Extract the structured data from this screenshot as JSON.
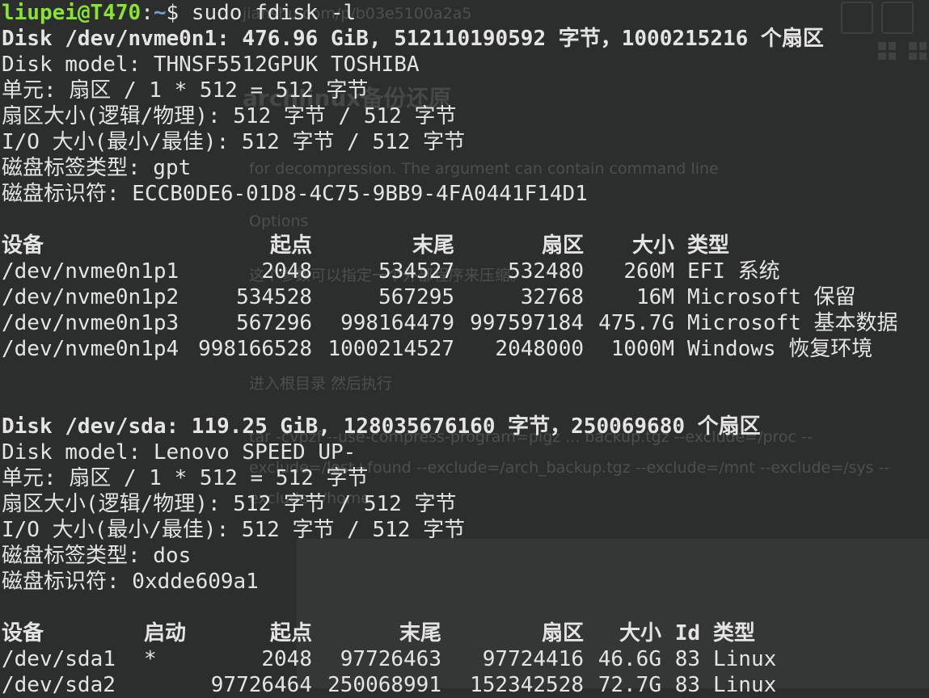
{
  "background": {
    "url_fragment": "jianshu.com/p/b03e5100a2a5",
    "heading": "archlinux备份还原",
    "line1": "for decompression. The argument can contain command line",
    "line2": "Options",
    "line3": "这个参数可以指定一个外部程序来压缩。",
    "line4": "进入根目录 然后执行",
    "line5": "tar -cvpzf --use-compress-program=pigz ... backup.tgz --exclude=/proc --",
    "line6": "exclude=/lost+found --exclude=/arch_backup.tgz --exclude=/mnt --exclude=/sys --",
    "line7": "exclude=/home"
  },
  "prompt": {
    "user_host": "liupei@T470",
    "sep": ":",
    "path": "~",
    "symbol": "$ ",
    "command": "sudo fdisk -l"
  },
  "disk1": {
    "header": "Disk /dev/nvme0n1: 476.96 GiB, 512110190592 字节，1000215216 个扇区",
    "model": "Disk model: THNSF5512GPUK TOSHIBA",
    "unit": "单元: 扇区 / 1 * 512 = 512 字节",
    "sector_size": "扇区大小(逻辑/物理): 512 字节 / 512 字节",
    "io_size": "I/O 大小(最小/最佳): 512 字节 / 512 字节",
    "label_type": "磁盘标签类型: gpt",
    "identifier": "磁盘标识符: ECCB0DE6-01D8-4C75-9BB9-4FA0441F14D1",
    "columns": [
      "设备",
      "起点",
      "末尾",
      "扇区",
      "大小",
      "类型"
    ],
    "rows": [
      [
        "/dev/nvme0n1p1",
        "2048",
        "534527",
        "532480",
        "260M",
        "EFI 系统"
      ],
      [
        "/dev/nvme0n1p2",
        "534528",
        "567295",
        "32768",
        "16M",
        "Microsoft 保留"
      ],
      [
        "/dev/nvme0n1p3",
        "567296",
        "998164479",
        "997597184",
        "475.7G",
        "Microsoft 基本数据"
      ],
      [
        "/dev/nvme0n1p4",
        "998166528",
        "1000214527",
        "2048000",
        "1000M",
        "Windows 恢复环境"
      ]
    ]
  },
  "disk2": {
    "header": "Disk /dev/sda: 119.25 GiB, 128035676160 字节，250069680 个扇区",
    "model": "Disk model: Lenovo SPEED UP-",
    "unit": "单元: 扇区 / 1 * 512 = 512 字节",
    "sector_size": "扇区大小(逻辑/物理): 512 字节 / 512 字节",
    "io_size": "I/O 大小(最小/最佳): 512 字节 / 512 字节",
    "label_type": "磁盘标签类型: dos",
    "identifier": "磁盘标识符: 0xdde609a1",
    "columns": [
      "设备",
      "启动",
      "起点",
      "末尾",
      "扇区",
      "大小",
      "Id",
      "类型"
    ],
    "rows": [
      [
        "/dev/sda1",
        "*",
        "2048",
        "97726463",
        "97724416",
        "46.6G",
        "83",
        "Linux"
      ],
      [
        "/dev/sda2",
        "",
        "97726464",
        "250068991",
        "152342528",
        "72.7G",
        "83",
        "Linux"
      ]
    ]
  }
}
